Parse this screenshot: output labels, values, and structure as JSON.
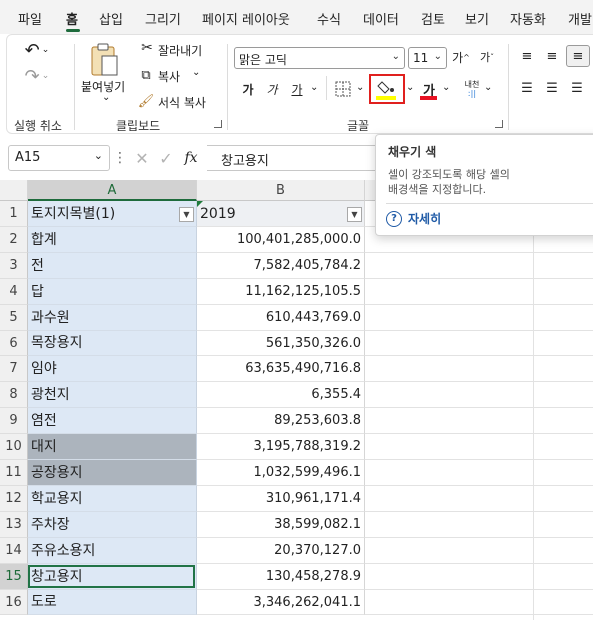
{
  "ribbon_tabs": [
    "파일",
    "홈",
    "삽입",
    "그리기",
    "페이지 레이아웃",
    "수식",
    "데이터",
    "검토",
    "보기",
    "자동화",
    "개발"
  ],
  "groups": {
    "undo_label": "실행 취소",
    "clipboard_label": "클립보드",
    "font_label": "글꼴"
  },
  "clipboard": {
    "paste": "붙여넣기",
    "cut": "잘라내기",
    "copy": "복사",
    "format_painter": "서식 복사"
  },
  "font": {
    "name": "맑은 고딕",
    "size": "11",
    "bold_glyph": "가",
    "italic_glyph": "가",
    "underline_glyph": "가",
    "font_color_glyph": "가",
    "phonetic_glyph": "내천",
    "fill_color": "#ffff00",
    "font_color": "#e81123"
  },
  "formula_bar": {
    "name_box": "A15",
    "fx": "fx",
    "content": "창고용지"
  },
  "columns": [
    "A",
    "B"
  ],
  "rows": [
    {
      "n": "1",
      "a": "토지지목별(1)",
      "b": "2019"
    },
    {
      "n": "2",
      "a": "합계",
      "b": "100,401,285,000.0"
    },
    {
      "n": "3",
      "a": "전",
      "b": "7,582,405,784.2"
    },
    {
      "n": "4",
      "a": "답",
      "b": "11,162,125,105.5"
    },
    {
      "n": "5",
      "a": "과수원",
      "b": "610,443,769.0"
    },
    {
      "n": "6",
      "a": "목장용지",
      "b": "561,350,326.0"
    },
    {
      "n": "7",
      "a": "임야",
      "b": "63,635,490,716.8"
    },
    {
      "n": "8",
      "a": "광천지",
      "b": "6,355.4"
    },
    {
      "n": "9",
      "a": "염전",
      "b": "89,253,603.8"
    },
    {
      "n": "10",
      "a": "대지",
      "b": "3,195,788,319.2"
    },
    {
      "n": "11",
      "a": "공장용지",
      "b": "1,032,599,496.1"
    },
    {
      "n": "12",
      "a": "학교용지",
      "b": "310,961,171.4"
    },
    {
      "n": "13",
      "a": "주차장",
      "b": "38,599,082.1"
    },
    {
      "n": "14",
      "a": "주유소용지",
      "b": "20,370,127.0"
    },
    {
      "n": "15",
      "a": "창고용지",
      "b": "130,458,278.9"
    },
    {
      "n": "16",
      "a": "도로",
      "b": "3,346,262,041.1"
    }
  ],
  "tooltip": {
    "title": "채우기 색",
    "line1": "셀이 강조되도록 해당 셀의",
    "line2": "배경색을 지정합니다.",
    "help": "자세히"
  }
}
